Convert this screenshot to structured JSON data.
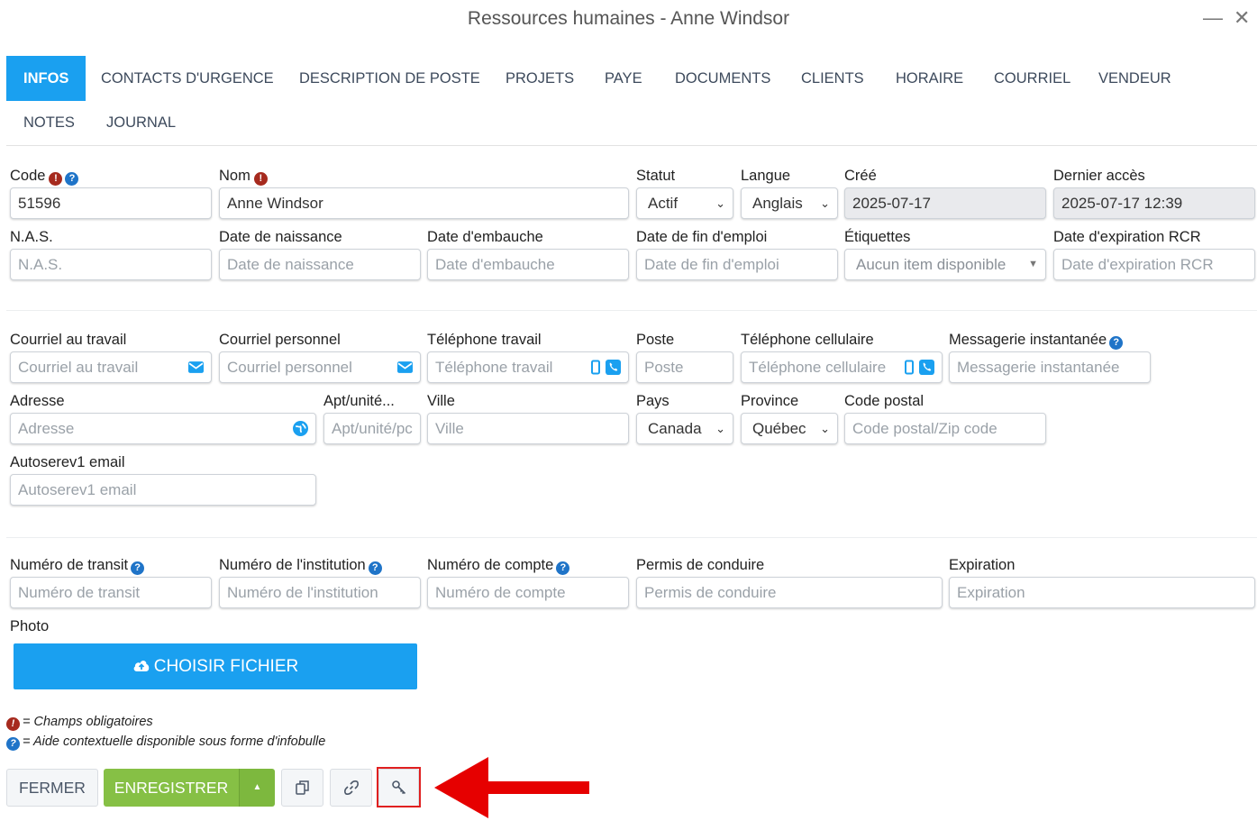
{
  "window": {
    "title": "Ressources humaines - Anne Windsor",
    "minimize": "—",
    "close": "✕"
  },
  "tabs": [
    {
      "label": "INFOS",
      "active": true
    },
    {
      "label": "CONTACTS D'URGENCE"
    },
    {
      "label": "DESCRIPTION DE POSTE"
    },
    {
      "label": "PROJETS"
    },
    {
      "label": "PAYE"
    },
    {
      "label": "DOCUMENTS"
    },
    {
      "label": "CLIENTS"
    },
    {
      "label": "HORAIRE"
    },
    {
      "label": "COURRIEL"
    },
    {
      "label": "VENDEUR"
    },
    {
      "label": "NOTES"
    },
    {
      "label": "JOURNAL"
    }
  ],
  "form": {
    "code": {
      "label": "Code",
      "value": "51596"
    },
    "nom": {
      "label": "Nom",
      "value": "Anne Windsor"
    },
    "statut": {
      "label": "Statut",
      "value": "Actif"
    },
    "langue": {
      "label": "Langue",
      "value": "Anglais"
    },
    "cree": {
      "label": "Créé",
      "value": "2025-07-17"
    },
    "dernier_acces": {
      "label": "Dernier accès",
      "value": "2025-07-17 12:39"
    },
    "nas": {
      "label": "N.A.S.",
      "placeholder": "N.A.S."
    },
    "date_naissance": {
      "label": "Date de naissance",
      "placeholder": "Date de naissance"
    },
    "date_embauche": {
      "label": "Date d'embauche",
      "placeholder": "Date d'embauche"
    },
    "date_fin_emploi": {
      "label": "Date de fin d'emploi",
      "placeholder": "Date de fin d'emploi"
    },
    "etiquettes": {
      "label": "Étiquettes",
      "placeholder": "Aucun item disponible"
    },
    "date_exp_rcr": {
      "label": "Date d'expiration RCR",
      "placeholder": "Date d'expiration RCR"
    },
    "courriel_travail": {
      "label": "Courriel au travail",
      "placeholder": "Courriel au travail"
    },
    "courriel_perso": {
      "label": "Courriel personnel",
      "placeholder": "Courriel personnel"
    },
    "tel_travail": {
      "label": "Téléphone travail",
      "placeholder": "Téléphone travail"
    },
    "poste": {
      "label": "Poste",
      "placeholder": "Poste"
    },
    "tel_cell": {
      "label": "Téléphone cellulaire",
      "placeholder": "Téléphone cellulaire"
    },
    "messagerie": {
      "label": "Messagerie instantanée",
      "placeholder": "Messagerie instantanée"
    },
    "adresse": {
      "label": "Adresse",
      "placeholder": "Adresse"
    },
    "apt": {
      "label": "Apt/unité...",
      "placeholder": "Apt/unité/pc"
    },
    "ville": {
      "label": "Ville",
      "placeholder": "Ville"
    },
    "pays": {
      "label": "Pays",
      "value": "Canada"
    },
    "province": {
      "label": "Province",
      "value": "Québec"
    },
    "code_postal": {
      "label": "Code postal",
      "placeholder": "Code postal/Zip code"
    },
    "autoserev": {
      "label": "Autoserev1 email",
      "placeholder": "Autoserev1 email"
    },
    "transit": {
      "label": "Numéro de transit",
      "placeholder": "Numéro de transit"
    },
    "institution": {
      "label": "Numéro de l'institution",
      "placeholder": "Numéro de l'institution"
    },
    "compte": {
      "label": "Numéro de compte",
      "placeholder": "Numéro de compte"
    },
    "permis": {
      "label": "Permis de conduire",
      "placeholder": "Permis de conduire"
    },
    "expiration": {
      "label": "Expiration",
      "placeholder": "Expiration"
    },
    "photo": {
      "label": "Photo",
      "button": "CHOISIR FICHIER"
    }
  },
  "legend": {
    "required": "= Champs obligatoires",
    "help": "= Aide contextuelle disponible sous forme d'infobulle"
  },
  "footer": {
    "close_label": "FERMER",
    "save_label": "ENREGISTRER"
  },
  "colors": {
    "accent": "#1aa0f0",
    "save": "#86c045",
    "required": "#a62a1e",
    "help": "#1f74c8",
    "highlight": "#e02020"
  },
  "icons": {
    "required": "exclamation-circle-icon",
    "help": "question-circle-icon",
    "email": "envelope-icon",
    "mobile": "mobile-phone-icon",
    "phone": "phone-icon",
    "globe": "globe-icon",
    "upload": "cloud-upload-icon",
    "copy": "copy-icon",
    "link": "link-icon",
    "key": "key-icon"
  }
}
